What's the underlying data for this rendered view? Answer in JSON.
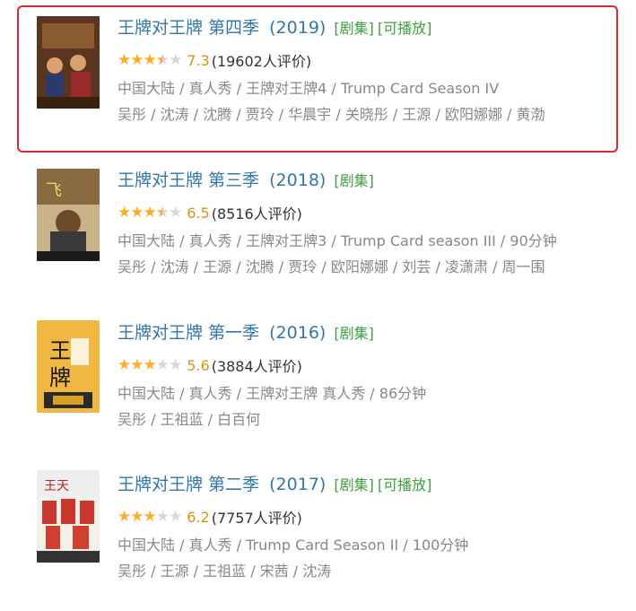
{
  "results": [
    {
      "title": "王牌对王牌 第四季",
      "year": "(2019)",
      "tags": [
        "[剧集]",
        "[可播放]"
      ],
      "rating": 7.3,
      "stars": 3.5,
      "rating_text": "7.3",
      "count": "(19602人评价)",
      "meta": "中国大陆 / 真人秀 / 王牌对王牌4 / Trump Card Season IV",
      "cast": "吴彤 / 沈涛 / 沈腾 / 贾玲 / 华晨宇 / 关晓彤 / 王源 / 欧阳娜娜 / 黄渤",
      "highlighted": true,
      "poster_color": "#7a4a2a"
    },
    {
      "title": "王牌对王牌 第三季",
      "year": "(2018)",
      "tags": [
        "[剧集]"
      ],
      "rating": 6.5,
      "stars": 3.5,
      "rating_text": "6.5",
      "count": "(8516人评价)",
      "meta": "中国大陆 / 真人秀 / 王牌对王牌3 / Trump Card season III / 90分钟",
      "cast": "吴彤 / 沈涛 / 王源 / 沈腾 / 贾玲 / 欧阳娜娜 / 刘芸 / 凌潇肃 / 周一围",
      "highlighted": false,
      "poster_color": "#b08a5a"
    },
    {
      "title": "王牌对王牌 第一季",
      "year": "(2016)",
      "tags": [
        "[剧集]"
      ],
      "rating": 5.6,
      "stars": 3,
      "rating_text": "5.6",
      "count": "(3884人评价)",
      "meta": "中国大陆 / 真人秀 / 王牌对王牌 真人秀 / 86分钟",
      "cast": "吴彤 / 王祖蓝 / 白百何",
      "highlighted": false,
      "poster_color": "#e6a53a"
    },
    {
      "title": "王牌对王牌 第二季",
      "year": "(2017)",
      "tags": [
        "[剧集]",
        "[可播放]"
      ],
      "rating": 6.2,
      "stars": 3,
      "rating_text": "6.2",
      "count": "(7757人评价)",
      "meta": "中国大陆 / 真人秀 / Trump Card Season II / 100分钟",
      "cast": "吴彤 / 王源 / 王祖蓝 / 宋茜 / 沈涛",
      "highlighted": false,
      "poster_color": "#c8362e"
    }
  ],
  "colors": {
    "title": "#3377aa",
    "tag": "#3f9f3f",
    "star": "#ffac2d",
    "highlight_border": "#e0262b"
  }
}
